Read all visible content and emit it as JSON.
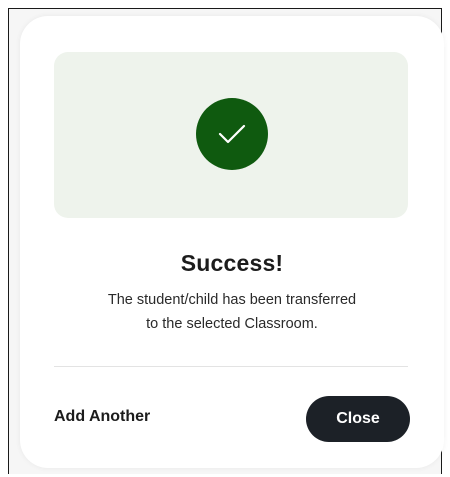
{
  "dialog": {
    "title": "Success!",
    "message_line1": "The student/child has been transferred",
    "message_line2": "to the selected Classroom.",
    "icon": "check-icon",
    "add_another_label": "Add Another",
    "close_label": "Close"
  },
  "colors": {
    "hero_background": "#eef3ec",
    "check_circle": "#0f5a0f",
    "close_button": "#1c2127"
  }
}
